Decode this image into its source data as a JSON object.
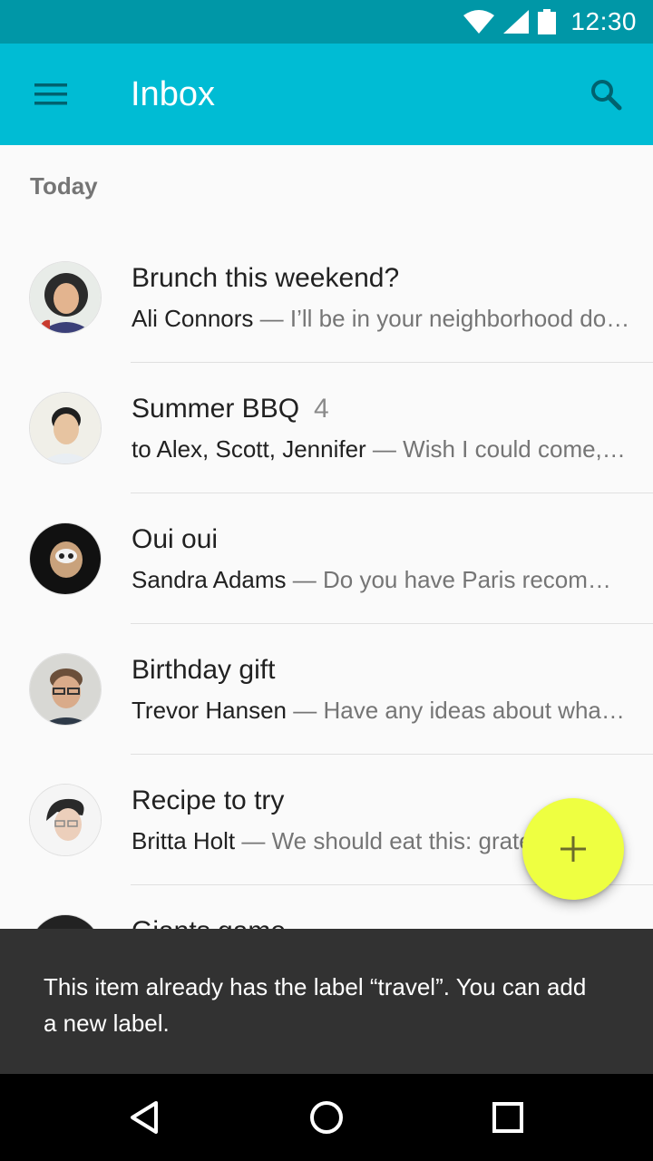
{
  "status_bar": {
    "time": "12:30",
    "icons": [
      "wifi-icon",
      "signal-icon",
      "battery-icon"
    ],
    "color": "#0097a7"
  },
  "app_bar": {
    "title": "Inbox",
    "color": "#00bcd4",
    "icons": [
      "menu-icon",
      "search-icon"
    ]
  },
  "section": {
    "header": "Today"
  },
  "messages": [
    {
      "subject": "Brunch this weekend?",
      "count": "",
      "sender": "Ali Connors",
      "sep": " — ",
      "snippet": "I’ll be in your neighborhood doing errands this weekend."
    },
    {
      "subject": "Summer BBQ",
      "count": "4",
      "sender": "to Alex, Scott, Jennifer",
      "sep": " — ",
      "snippet": "Wish I could come, but I’m out of town this weekend."
    },
    {
      "subject": "Oui oui",
      "count": "",
      "sender": "Sandra Adams",
      "sep": " — ",
      "snippet": "Do you have Paris recommendations? Have you ever been?"
    },
    {
      "subject": "Birthday gift",
      "count": "",
      "sender": "Trevor Hansen",
      "sep": " — ",
      "snippet": "Have any ideas about what we should get Heidi for her birthday?"
    },
    {
      "subject": "Recipe to try",
      "count": "",
      "sender": "Britta Holt",
      "sep": " — ",
      "snippet": "We should eat this: grated squash. Corn and tomatillo tacos."
    },
    {
      "subject": "Giants game",
      "count": "",
      "sender": "",
      "sep": "",
      "snippet": ""
    }
  ],
  "fab": {
    "icon": "add-icon",
    "color": "#eeff41"
  },
  "snackbar": {
    "text": "This item already has the label “travel”. You can add a new label."
  },
  "nav_bar": {
    "icons": [
      "back-icon",
      "home-icon",
      "recents-icon"
    ]
  }
}
